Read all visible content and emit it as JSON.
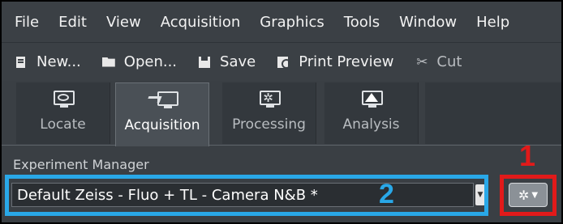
{
  "menubar": {
    "items": [
      "File",
      "Edit",
      "View",
      "Acquisition",
      "Graphics",
      "Tools",
      "Window",
      "Help"
    ]
  },
  "toolbar": {
    "new_label": "New...",
    "open_label": "Open...",
    "save_label": "Save",
    "print_preview_label": "Print Preview",
    "cut_label": "Cut"
  },
  "tabs": [
    {
      "label": "Locate",
      "icon": "locate-icon",
      "active": false
    },
    {
      "label": "Acquisition",
      "icon": "acquisition-icon",
      "active": true
    },
    {
      "label": "Processing",
      "icon": "processing-icon",
      "active": false
    },
    {
      "label": "Analysis",
      "icon": "analysis-icon",
      "active": false
    }
  ],
  "experiment_manager": {
    "label": "Experiment Manager",
    "selected_value": "Default Zeiss - Fluo + TL - Camera N&B *"
  },
  "annotations": {
    "marker_1": "1",
    "marker_2": "2",
    "color_red": "#e11a1a",
    "color_blue": "#29a8e8"
  }
}
